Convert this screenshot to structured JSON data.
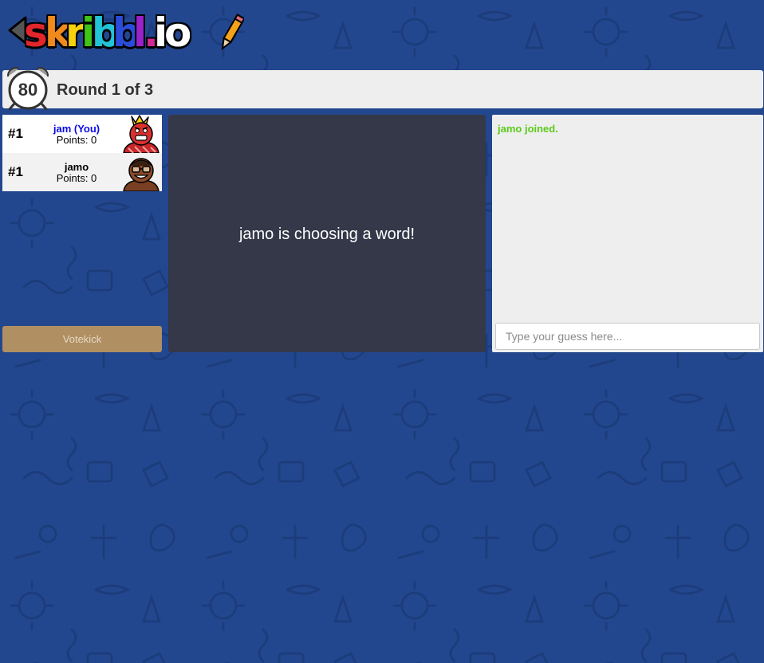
{
  "logo": {
    "text": "skribbl.io",
    "letters": [
      {
        "ch": "s",
        "color": "#e2262b"
      },
      {
        "ch": "k",
        "color": "#f08a1d"
      },
      {
        "ch": "r",
        "color": "#f9d20e"
      },
      {
        "ch": "i",
        "color": "#3fc418"
      },
      {
        "ch": "b",
        "color": "#22c3d6"
      },
      {
        "ch": "b",
        "color": "#2b4cd8"
      },
      {
        "ch": "l",
        "color": "#9b21c9"
      },
      {
        "ch": ".",
        "color": "#d42a94"
      },
      {
        "ch": "i",
        "color": "#ffffff"
      },
      {
        "ch": "o",
        "color": "#ffffff"
      }
    ]
  },
  "header": {
    "timer": "80",
    "round_text": "Round 1 of 3"
  },
  "players": [
    {
      "rank": "#1",
      "name": "jam (You)",
      "points": "Points: 0",
      "is_self": true,
      "avatar": "red-face-with-crown",
      "skin": "#d9302f"
    },
    {
      "rank": "#1",
      "name": "jamo",
      "points": "Points: 0",
      "is_self": false,
      "avatar": "brown-face-with-glasses",
      "skin": "#8b4a2a"
    }
  ],
  "votekick_label": "Votekick",
  "canvas": {
    "overlay_text": "jamo is choosing a word!"
  },
  "chat": {
    "messages": [
      {
        "text": "jamo joined.",
        "color": "#5bcb1a"
      }
    ],
    "input_placeholder": "Type your guess here..."
  },
  "colors": {
    "background": "#23478f",
    "canvas": "#343849",
    "panel": "#eeeeee",
    "votekick": "#b08f62",
    "self_name": "#0a0ae8",
    "join_message": "#5bcb1a"
  }
}
